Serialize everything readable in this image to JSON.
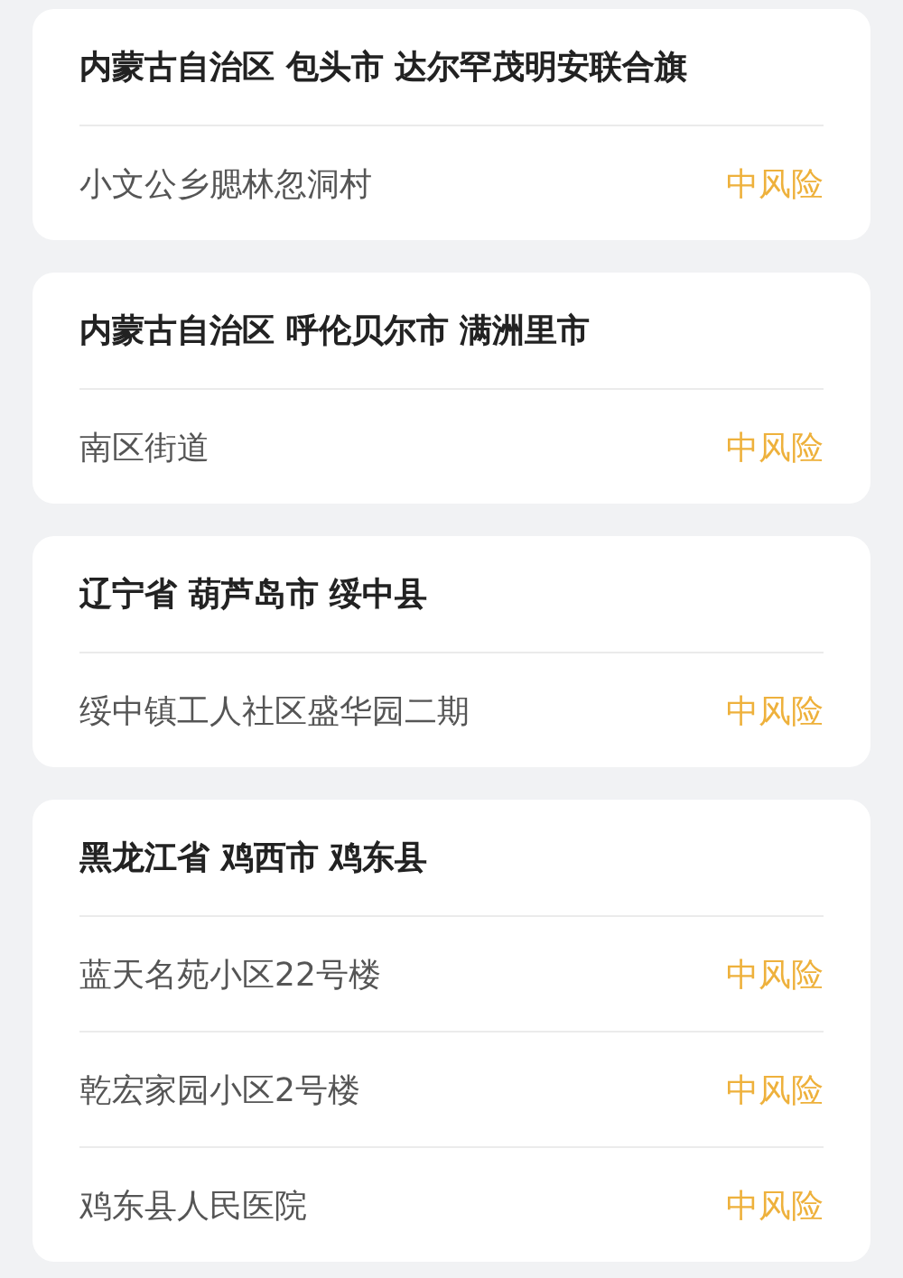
{
  "areas": [
    {
      "region": "内蒙古自治区 包头市 达尔罕茂明安联合旗",
      "places": [
        {
          "name": "小文公乡腮林忽洞村",
          "risk": "中风险"
        }
      ]
    },
    {
      "region": "内蒙古自治区 呼伦贝尔市 满洲里市",
      "places": [
        {
          "name": "南区街道",
          "risk": "中风险"
        }
      ]
    },
    {
      "region": "辽宁省 葫芦岛市 绥中县",
      "places": [
        {
          "name": "绥中镇工人社区盛华园二期",
          "risk": "中风险"
        }
      ]
    },
    {
      "region": "黑龙江省 鸡西市 鸡东县",
      "places": [
        {
          "name": "蓝天名苑小区22号楼",
          "risk": "中风险"
        },
        {
          "name": "乾宏家园小区2号楼",
          "risk": "中风险"
        },
        {
          "name": "鸡东县人民医院",
          "risk": "中风险"
        }
      ]
    }
  ]
}
